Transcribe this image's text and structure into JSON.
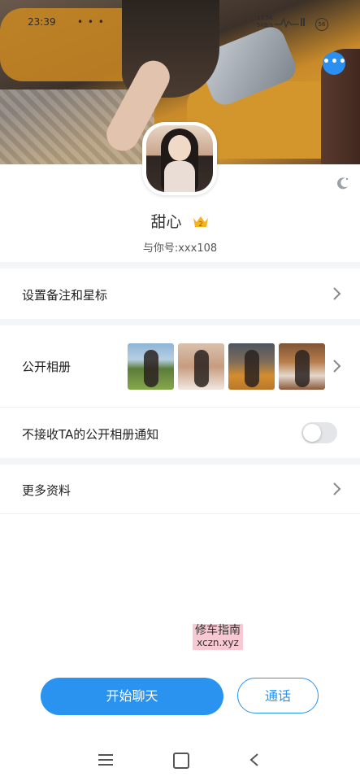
{
  "status_bar": {
    "time": "23:39",
    "dots": "• • •",
    "network": "13.5K\n5KB/s",
    "battery": "56"
  },
  "profile": {
    "name": "甜心",
    "level": "2",
    "id_label": "与你号:xxx108"
  },
  "rows": {
    "remark": "设置备注和星标",
    "album": "公开相册",
    "no_notify": "不接收TA的公开相册通知",
    "more_info": "更多资料"
  },
  "toggle": {
    "no_notify_on": false
  },
  "watermark": {
    "title": "修车指南",
    "url": "xczn.xyz"
  },
  "actions": {
    "chat": "开始聊天",
    "call": "通话"
  },
  "colors": {
    "accent": "#2a93ef",
    "crown": "#f5b21a",
    "separator": "#f4f5f7"
  },
  "icons": [
    "more-icon",
    "moon-icon",
    "crown-icon",
    "chevron-right-icon",
    "menu-icon",
    "home-icon",
    "back-icon"
  ]
}
